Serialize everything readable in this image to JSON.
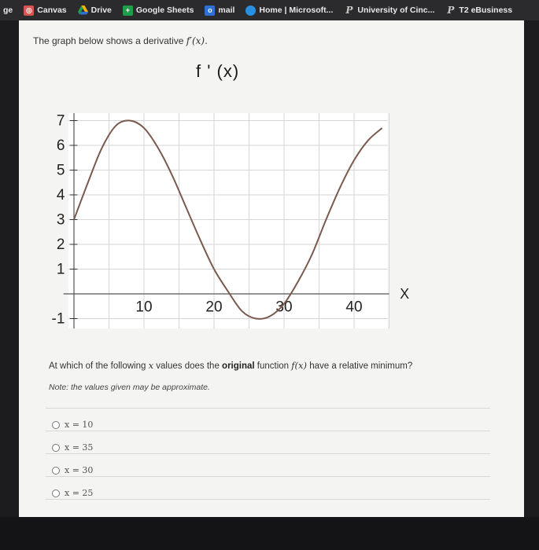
{
  "bookmarks": {
    "partial": "ge",
    "items": [
      {
        "label": "Canvas"
      },
      {
        "label": "Drive"
      },
      {
        "label": "Google Sheets"
      },
      {
        "label": "mail"
      },
      {
        "label": "Home | Microsoft..."
      },
      {
        "label": "University of Cinc..."
      },
      {
        "label": "T2 eBusiness"
      }
    ]
  },
  "question": {
    "intro_text": "The graph below shows a derivative",
    "intro_math": "f′(x).",
    "chart_title": "f ' (x)",
    "prompt_part1": "At which of the following",
    "prompt_var": "x",
    "prompt_part2": "values does the",
    "prompt_bold": "original",
    "prompt_part3": "function",
    "prompt_func": "f(x)",
    "prompt_part4": "have a relative minimum?",
    "note": "Note: the values given may be approximate.",
    "options": [
      {
        "label": "x = 10"
      },
      {
        "label": "x = 35"
      },
      {
        "label": "x = 30"
      },
      {
        "label": "x = 25"
      }
    ]
  },
  "chart_data": {
    "type": "line",
    "title": "f ' (x)",
    "xlabel": "X",
    "ylabel": "",
    "xlim": [
      -2,
      45
    ],
    "ylim": [
      -1,
      7
    ],
    "x_tick_labels": [
      "10",
      "20",
      "30",
      "40"
    ],
    "y_tick_labels": [
      "7",
      "6",
      "5",
      "4",
      "3",
      "2",
      "1",
      "-1"
    ],
    "grid": true,
    "series": [
      {
        "x": [
          0,
          2,
          4,
          6,
          8,
          10,
          12,
          14,
          16,
          18,
          20,
          22,
          24,
          26,
          28,
          30,
          32,
          34,
          36,
          38,
          40,
          42,
          44
        ],
        "y": [
          3.0,
          4.5,
          5.9,
          6.8,
          7.0,
          6.7,
          5.9,
          4.8,
          3.5,
          2.2,
          1.0,
          0.1,
          -0.7,
          -1.0,
          -0.9,
          -0.4,
          0.5,
          1.6,
          3.0,
          4.3,
          5.4,
          6.2,
          6.7
        ]
      }
    ]
  }
}
